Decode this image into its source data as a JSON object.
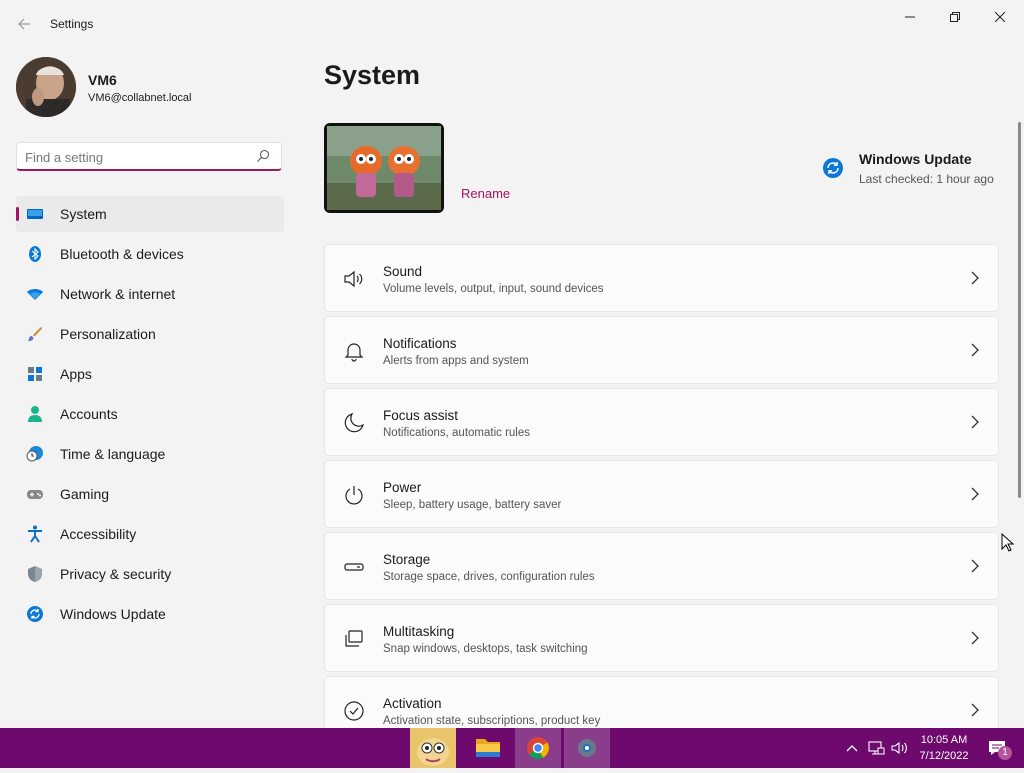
{
  "app": {
    "title": "Settings"
  },
  "user": {
    "name": "VM6",
    "email": "VM6@collabnet.local"
  },
  "search": {
    "placeholder": "Find a setting"
  },
  "nav": [
    {
      "label": "System",
      "icon": "monitor-icon",
      "active": true
    },
    {
      "label": "Bluetooth & devices",
      "icon": "bluetooth-icon"
    },
    {
      "label": "Network & internet",
      "icon": "wifi-icon"
    },
    {
      "label": "Personalization",
      "icon": "brush-icon"
    },
    {
      "label": "Apps",
      "icon": "apps-icon"
    },
    {
      "label": "Accounts",
      "icon": "person-icon"
    },
    {
      "label": "Time & language",
      "icon": "globe-clock-icon"
    },
    {
      "label": "Gaming",
      "icon": "gamepad-icon"
    },
    {
      "label": "Accessibility",
      "icon": "accessibility-icon"
    },
    {
      "label": "Privacy & security",
      "icon": "shield-icon"
    },
    {
      "label": "Windows Update",
      "icon": "update-icon"
    }
  ],
  "page": {
    "title": "System",
    "rename": "Rename",
    "windows_update": {
      "title": "Windows Update",
      "subtitle": "Last checked: 1 hour ago"
    }
  },
  "cards": [
    {
      "title": "Sound",
      "subtitle": "Volume levels, output, input, sound devices",
      "icon": "speaker-icon"
    },
    {
      "title": "Notifications",
      "subtitle": "Alerts from apps and system",
      "icon": "bell-icon"
    },
    {
      "title": "Focus assist",
      "subtitle": "Notifications, automatic rules",
      "icon": "moon-icon"
    },
    {
      "title": "Power",
      "subtitle": "Sleep, battery usage, battery saver",
      "icon": "power-icon"
    },
    {
      "title": "Storage",
      "subtitle": "Storage space, drives, configuration rules",
      "icon": "drive-icon"
    },
    {
      "title": "Multitasking",
      "subtitle": "Snap windows, desktops, task switching",
      "icon": "multitask-icon"
    },
    {
      "title": "Activation",
      "subtitle": "Activation state, subscriptions, product key",
      "icon": "check-circle-icon"
    }
  ],
  "taskbar": {
    "time": "10:05 AM",
    "date": "7/12/2022",
    "notification_count": "1"
  },
  "colors": {
    "accent": "#a3145e",
    "taskbar": "#6e0a6e"
  }
}
